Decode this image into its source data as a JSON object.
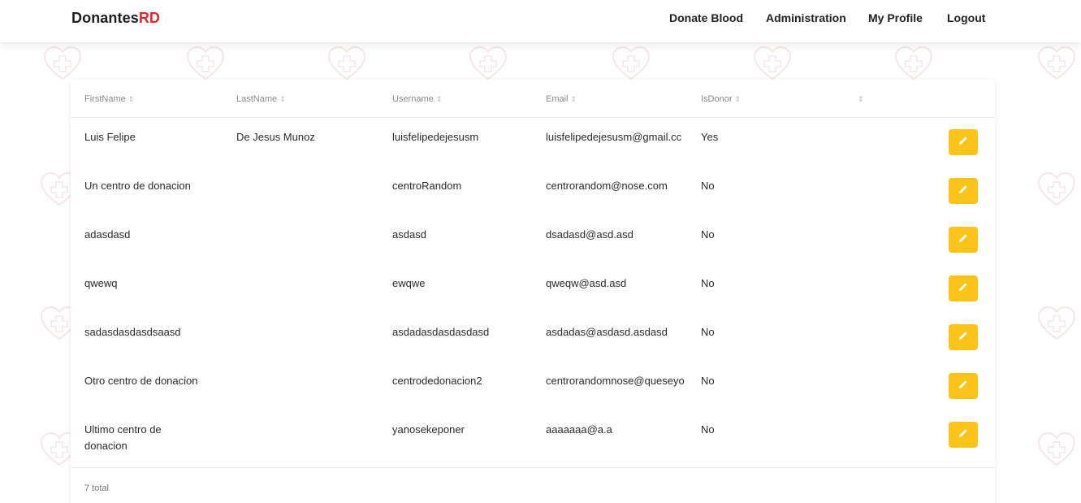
{
  "header": {
    "brand_prefix": "Donantes",
    "brand_suffix": "RD",
    "nav": [
      "Donate Blood",
      "Administration",
      "My Profile",
      "Logout"
    ]
  },
  "table": {
    "columns": [
      "FirstName",
      "LastName",
      "Username",
      "Email",
      "IsDonor",
      ""
    ],
    "rows": [
      {
        "first": "Luis Felipe",
        "last": "De Jesus Munoz",
        "username": "luisfelipedejesusm",
        "email": "luisfelipedejesusm@gmail.cc",
        "donor": "Yes"
      },
      {
        "first": "Un centro de donacion",
        "last": "",
        "username": "centroRandom",
        "email": "centrorandom@nose.com",
        "donor": "No"
      },
      {
        "first": "adasdasd",
        "last": "",
        "username": "asdasd",
        "email": "dsadasd@asd.asd",
        "donor": "No"
      },
      {
        "first": "qwewq",
        "last": "",
        "username": "ewqwe",
        "email": "qweqw@asd.asd",
        "donor": "No"
      },
      {
        "first": "sadasdasdasdsaasd",
        "last": "",
        "username": "asdadasdasdasdasd",
        "email": "asdadas@asdasd.asdasd",
        "donor": "No"
      },
      {
        "first": "Otro centro de donacion",
        "last": "",
        "username": "centrodedonacion2",
        "email": "centrorandomnose@queseyo",
        "donor": "No"
      },
      {
        "first": "Ultimo centro de donacion",
        "last": "",
        "username": "yanosekeponer",
        "email": "aaaaaaa@a.a",
        "donor": "No"
      }
    ],
    "total_label": "7 total"
  },
  "colors": {
    "brand_accent": "#e0282e",
    "edit_button": "#fcc419",
    "pattern_heart": "#f0d2d2"
  },
  "icons": {
    "sort": "sort-icon",
    "edit": "pencil-icon",
    "pattern": "heart-cross-icon"
  }
}
